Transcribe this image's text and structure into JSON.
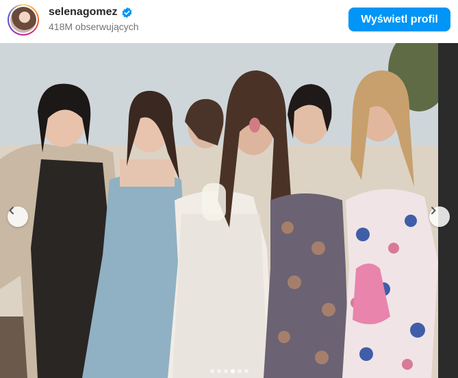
{
  "header": {
    "username": "selenagomez",
    "followers": "418M obserwujących",
    "view_profile_label": "Wyświetl profil"
  },
  "icons": {
    "verified": "verified-badge-icon",
    "prev": "chevron-left-icon",
    "next": "chevron-right-icon"
  },
  "colors": {
    "accent": "#0095f6",
    "verified": "#0095f6",
    "secondary_text": "#737373"
  },
  "carousel": {
    "total_slides": 6,
    "active_slide": 4
  }
}
